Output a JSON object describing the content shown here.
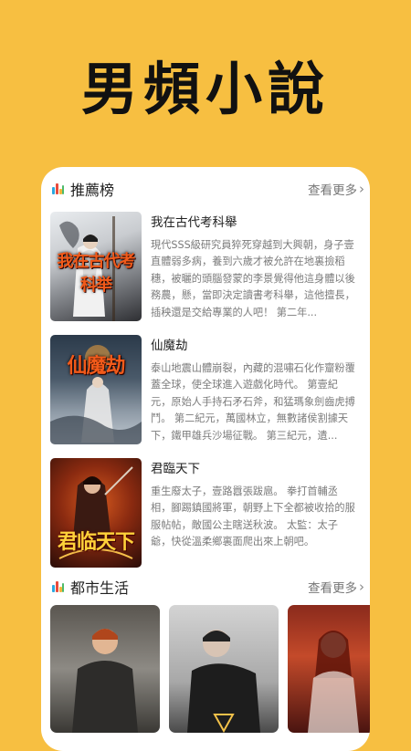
{
  "headline": "男頻小說",
  "sections": {
    "recommend": {
      "title": "推薦榜",
      "more": "查看更多"
    },
    "urban": {
      "title": "都市生活",
      "more": "查看更多"
    }
  },
  "books": [
    {
      "title": "我在古代考科舉",
      "cover_text": "我在古代考科举",
      "desc": "現代SSS級研究員猝死穿越到大興朝，身子壹直體弱多病，養到六歲才被允許在地裏撿稻穗，被曬的頭腦發蒙的李景覺得他這身體以後務農，懸，當即決定讀書考科舉，這他擅長，插秧還是交給專業的人吧！ 第二年..."
    },
    {
      "title": "仙魔劫",
      "cover_text": "仙魔劫",
      "desc": "泰山地震山體崩裂，內藏的混嘯石化作齏粉覆蓋全球，使全球進入遊戲化時代。 第壹紀元，原始人手持石矛石斧，和猛瑪象劍齒虎搏鬥。 第二紀元，萬國林立，無數諸侯割據天下，鐵甲雄兵沙場征戰。 第三紀元，遺..."
    },
    {
      "title": "君臨天下",
      "cover_text": "君临天下",
      "desc": "重生廢太子，壹路囂張跋扈。 拳打首輔丞相，腳踢鎮國將軍，朝野上下全都被收拾的服服帖帖，敵國公主瞎送秋波。 太監：太子爺，快從溫柔鄉裏面爬出來上朝吧。"
    }
  ],
  "colors": {
    "background": "#F7BF41",
    "card": "#FFFFFF",
    "text": "#222222",
    "muted": "#7B7B7B"
  }
}
